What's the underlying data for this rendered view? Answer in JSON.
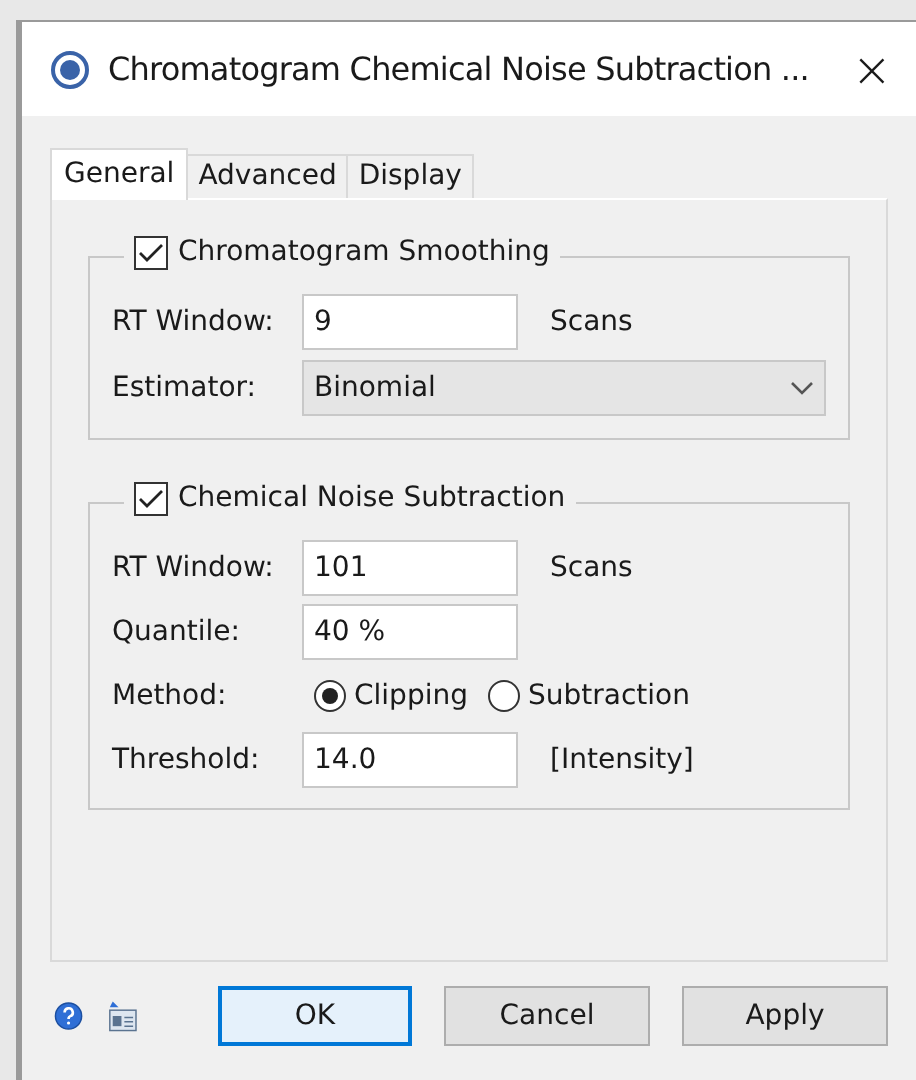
{
  "window": {
    "title": "Chromatogram Chemical Noise Subtraction ...",
    "close": "×"
  },
  "tabs": [
    {
      "label": "General",
      "selected": true
    },
    {
      "label": "Advanced",
      "selected": false
    },
    {
      "label": "Display",
      "selected": false
    }
  ],
  "groups": [
    {
      "label": "Chromatogram Smoothing",
      "checked": true,
      "rows": [
        {
          "kind": "text",
          "label": "RT Window:",
          "value": "9",
          "unit": "Scans"
        },
        {
          "kind": "select",
          "label": "Estimator:",
          "value": "Binomial"
        }
      ]
    },
    {
      "label": "Chemical Noise Subtraction",
      "checked": true,
      "rows": [
        {
          "kind": "text",
          "label": "RT Window:",
          "value": "101",
          "unit": "Scans"
        },
        {
          "kind": "text",
          "label": "Quantile:",
          "value": "40 %"
        },
        {
          "kind": "radio",
          "label": "Method:",
          "options": [
            {
              "label": "Clipping",
              "selected": true
            },
            {
              "label": "Subtraction",
              "selected": false
            }
          ]
        },
        {
          "kind": "text",
          "label": "Threshold:",
          "value": "14.0",
          "unit": "[Intensity]"
        }
      ]
    }
  ],
  "buttons": [
    {
      "label": "OK",
      "default": true
    },
    {
      "label": "Cancel",
      "default": false
    },
    {
      "label": "Apply",
      "default": false
    }
  ]
}
